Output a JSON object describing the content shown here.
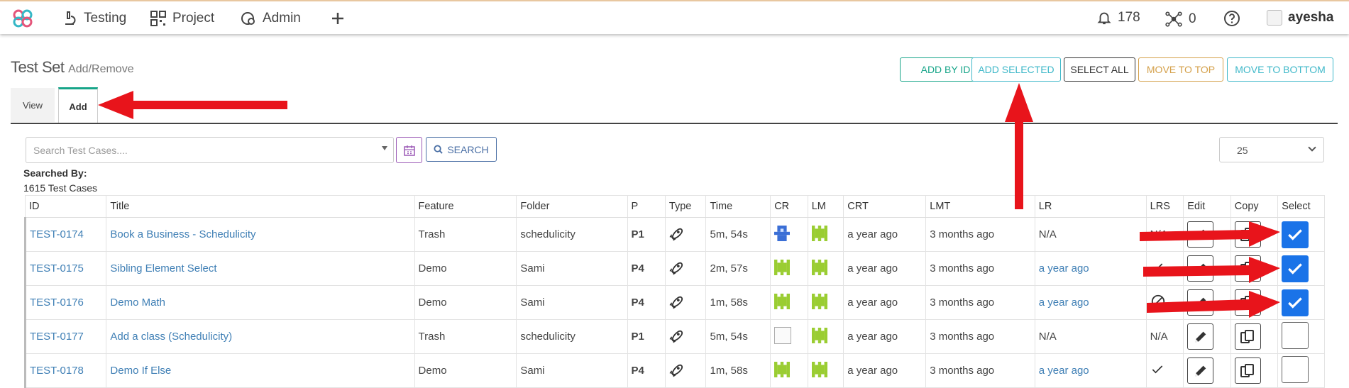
{
  "nav": {
    "items": [
      {
        "label": "Testing",
        "icon": "microscope-icon"
      },
      {
        "label": "Project",
        "icon": "qr-code-icon"
      },
      {
        "label": "Admin",
        "icon": "gear-shield-icon"
      }
    ],
    "notifications_count": "178",
    "network_count": "0",
    "username": "ayesha"
  },
  "page": {
    "title": "Test Set",
    "subtitle": "Add/Remove"
  },
  "actions": {
    "add_by_id": "ADD BY ID",
    "add_selected": "ADD SELECTED",
    "select_all": "SELECT ALL",
    "move_to_top": "MOVE TO TOP",
    "move_to_bottom": "MOVE TO BOTTOM"
  },
  "tabs": {
    "view": "View",
    "add": "Add",
    "active": "Add"
  },
  "search": {
    "placeholder": "Search Test Cases....",
    "button": "SEARCH",
    "per_page": "25"
  },
  "summary": {
    "searched_by": "Searched By:",
    "count": "1615 Test Cases"
  },
  "table": {
    "headers": [
      "ID",
      "Title",
      "Feature",
      "Folder",
      "P",
      "Type",
      "Time",
      "CR",
      "LM",
      "CRT",
      "LMT",
      "LR",
      "LRS",
      "Edit",
      "Copy",
      "Select"
    ],
    "rows": [
      {
        "id": "TEST-0174",
        "title": "Book a Business - Schedulicity",
        "feature": "Trash",
        "folder": "schedulicity",
        "p": "P1",
        "time": "5m, 54s",
        "crt": "a year ago",
        "lmt": "3 months ago",
        "lr": "N/A",
        "lr_link": false,
        "lrs": "N/A",
        "selected": true
      },
      {
        "id": "TEST-0175",
        "title": "Sibling Element Select",
        "feature": "Demo",
        "folder": "Sami",
        "p": "P4",
        "time": "2m, 57s",
        "crt": "a year ago",
        "lmt": "3 months ago",
        "lr": "a year ago",
        "lr_link": true,
        "lrs": "check",
        "selected": true
      },
      {
        "id": "TEST-0176",
        "title": "Demo Math",
        "feature": "Demo",
        "folder": "Sami",
        "p": "P4",
        "time": "1m, 58s",
        "crt": "a year ago",
        "lmt": "3 months ago",
        "lr": "a year ago",
        "lr_link": true,
        "lrs": "blocked",
        "selected": true
      },
      {
        "id": "TEST-0177",
        "title": "Add a class (Schedulicity)",
        "feature": "Trash",
        "folder": "schedulicity",
        "p": "P1",
        "time": "5m, 54s",
        "crt": "a year ago",
        "lmt": "3 months ago",
        "lr": "N/A",
        "lr_link": false,
        "lrs": "N/A",
        "selected": false
      },
      {
        "id": "TEST-0178",
        "title": "Demo If Else",
        "feature": "Demo",
        "folder": "Sami",
        "p": "P4",
        "time": "1m, 58s",
        "crt": "a year ago",
        "lmt": "3 months ago",
        "lr": "a year ago",
        "lr_link": true,
        "lrs": "check",
        "selected": false
      }
    ]
  },
  "colors": {
    "teal": "#17a589",
    "cyan": "#3fb8c9",
    "orange": "#d4a04a",
    "select_blue": "#1a73e8",
    "link_blue": "#3f7fb5",
    "arrow_red": "#e8141b",
    "avatar_green": "#9acd32",
    "avatar_blue": "#3b6fd6"
  }
}
